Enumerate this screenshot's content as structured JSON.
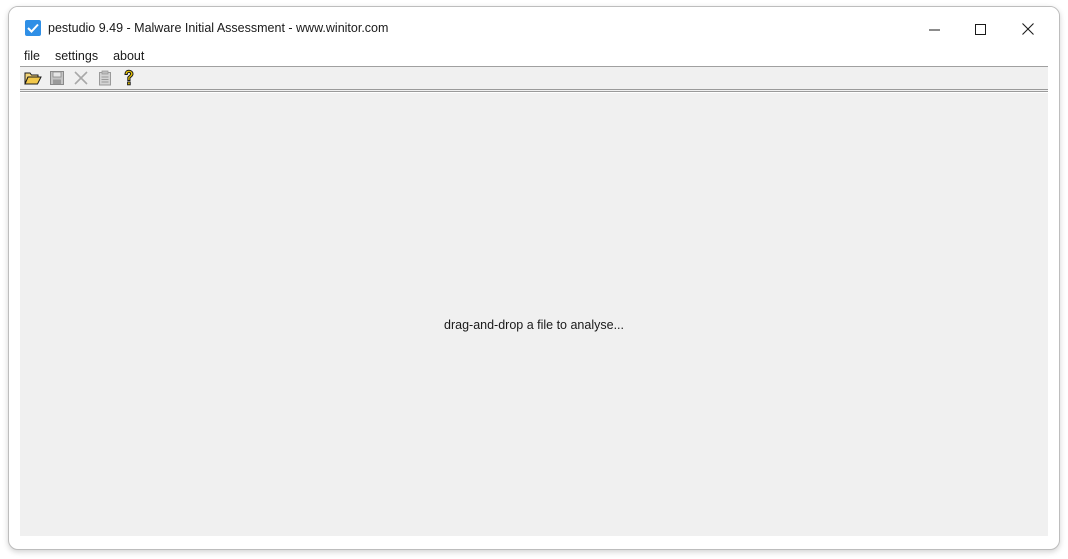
{
  "window": {
    "title": "pestudio 9.49 - Malware Initial Assessment - www.winitor.com"
  },
  "titlebar_controls": {
    "minimize_icon": "minimize-icon",
    "maximize_icon": "maximize-icon",
    "close_icon": "close-icon"
  },
  "menu": {
    "items": [
      {
        "label": "file"
      },
      {
        "label": "settings"
      },
      {
        "label": "about"
      }
    ]
  },
  "toolbar": {
    "buttons": [
      {
        "icon": "open-folder-icon",
        "enabled": true
      },
      {
        "icon": "save-icon",
        "enabled": false
      },
      {
        "icon": "close-file-icon",
        "enabled": false
      },
      {
        "icon": "clipboard-icon",
        "enabled": false
      },
      {
        "icon": "help-icon",
        "enabled": true
      }
    ]
  },
  "main": {
    "hint": "drag-and-drop a file to analyse..."
  },
  "colors": {
    "app_icon": "#2f8fe6",
    "content_bg": "#f0f0f0",
    "disabled_icon": "#a8a8a8",
    "help_icon": "#e8c400"
  }
}
